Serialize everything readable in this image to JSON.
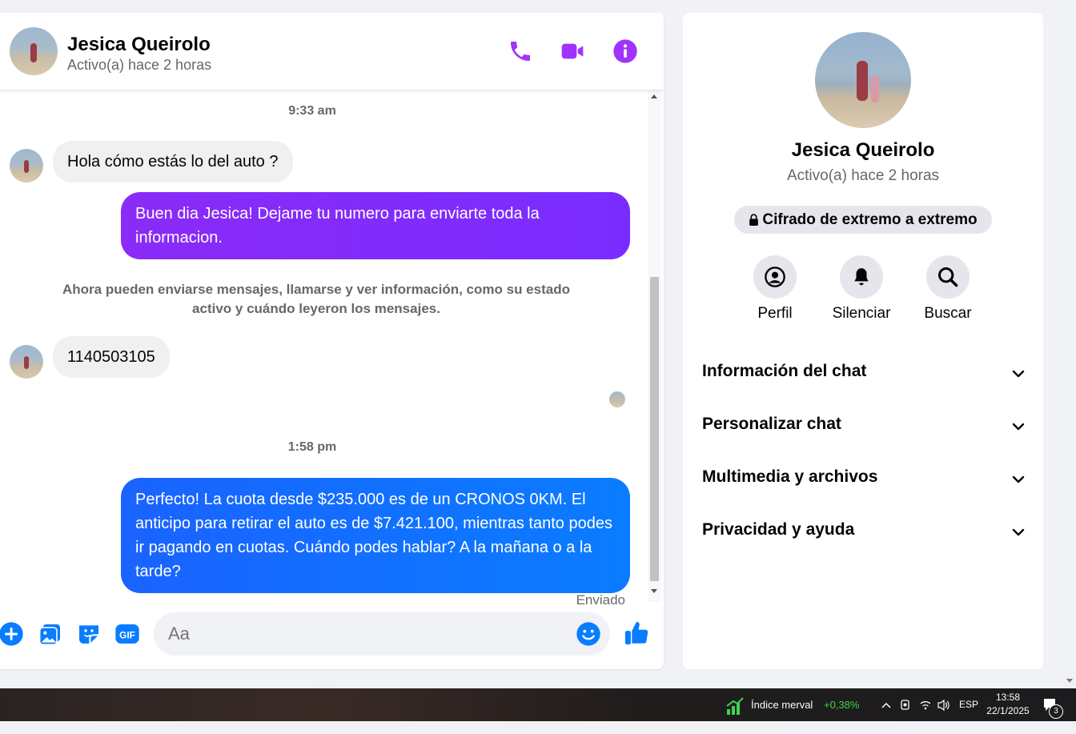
{
  "header": {
    "name": "Jesica Queirolo",
    "status": "Activo(a) hace 2 horas",
    "icons": [
      "phone-icon",
      "video-camera-icon",
      "info-icon"
    ]
  },
  "messages": {
    "time1": "9:33 am",
    "incoming1": "Hola cómo estás lo del auto ?",
    "outgoing1": "Buen dia Jesica! Dejame tu numero para enviarte toda la informacion.",
    "system_note": "Ahora pueden enviarse mensajes, llamarse y ver información, como su estado activo y cuándo leyeron los mensajes.",
    "incoming2": "1140503105",
    "time2": "1:58 pm",
    "outgoing2": "Perfecto! La cuota desde $235.000 es de un CRONOS 0KM. El anticipo para retirar el auto es de $7.421.100, mientras tanto podes ir pagando en cuotas. Cuándo podes hablar? A la mañana o a la tarde?",
    "sent_status": "Enviado"
  },
  "composer": {
    "placeholder": "Aa",
    "icons": [
      "plus-icon",
      "photo-icon",
      "sticker-icon",
      "gif-icon",
      "emoji-icon",
      "thumbs-up-icon"
    ]
  },
  "info_panel": {
    "name": "Jesica Queirolo",
    "status": "Activo(a) hace 2 horas",
    "encryption": "Cifrado de extremo a extremo",
    "actions": [
      {
        "label": "Perfil",
        "icon": "profile-icon"
      },
      {
        "label": "Silenciar",
        "icon": "bell-icon"
      },
      {
        "label": "Buscar",
        "icon": "search-icon"
      }
    ],
    "sections": [
      {
        "label": "Información del chat"
      },
      {
        "label": "Personalizar chat"
      },
      {
        "label": "Multimedia y archivos"
      },
      {
        "label": "Privacidad y ayuda"
      }
    ]
  },
  "taskbar": {
    "widget_label": "Índice merval",
    "widget_value": "+0,38%",
    "language": "ESP",
    "time": "13:58",
    "date": "22/1/2025",
    "notifications": "3"
  },
  "colors": {
    "accent_purple": "#a033ff",
    "accent_blue": "#0a7cff",
    "bubble_purple": "#7b2dfa",
    "bubble_in": "#f0f0f0",
    "positive_green": "#3dd44f"
  }
}
